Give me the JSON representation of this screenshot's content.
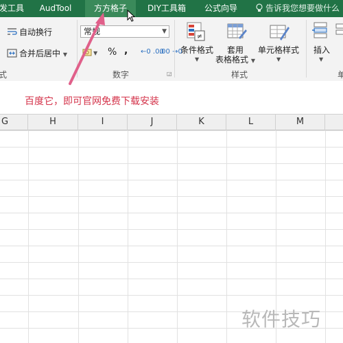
{
  "tabs": [
    {
      "label": "发工具"
    },
    {
      "label": "AudTool"
    },
    {
      "label": "方方格子",
      "active": true
    },
    {
      "label": "DIY工具箱"
    },
    {
      "label": "公式向导"
    }
  ],
  "tell_me": "告诉我您想要做什么",
  "ribbon": {
    "wrap_text": "自动换行",
    "merge_center": "合并后居中",
    "number_format": "常规",
    "percent": "%",
    "comma": ",",
    "inc_decimal": "←0 .00",
    "dec_decimal": ".00 →0",
    "cond_format": "条件格式",
    "table_format_line1": "套用",
    "table_format_line2": "表格格式",
    "cell_style": "单元格样式",
    "insert": "插入",
    "group_align_partial": "式",
    "group_number": "数字",
    "group_styles": "样式",
    "group_cells_partial": "单"
  },
  "message": "百度它，即可官网免费下载安装",
  "columns": [
    "G",
    "H",
    "I",
    "J",
    "K",
    "L",
    "M"
  ],
  "watermark": "软件技巧",
  "colors": {
    "tab_bar": "#217346",
    "active_tab": "#3a8a5a",
    "message_text": "#d4334a",
    "arrow": "#e0608a"
  }
}
